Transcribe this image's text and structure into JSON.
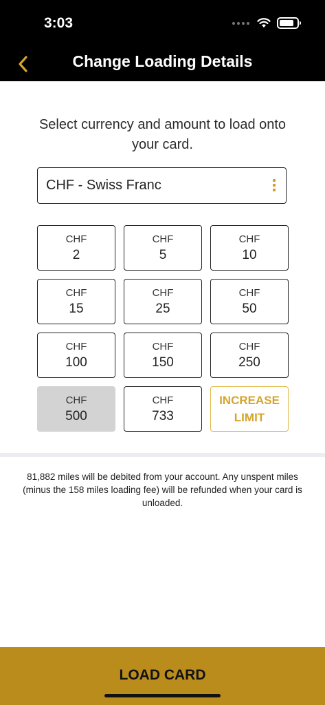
{
  "status_bar": {
    "time": "3:03"
  },
  "header": {
    "title": "Change Loading Details"
  },
  "instruction": "Select currency and amount to load onto your card.",
  "currency_select": {
    "value": "CHF - Swiss Franc"
  },
  "amounts": [
    {
      "currency": "CHF",
      "amount": "2"
    },
    {
      "currency": "CHF",
      "amount": "5"
    },
    {
      "currency": "CHF",
      "amount": "10"
    },
    {
      "currency": "CHF",
      "amount": "15"
    },
    {
      "currency": "CHF",
      "amount": "25"
    },
    {
      "currency": "CHF",
      "amount": "50"
    },
    {
      "currency": "CHF",
      "amount": "100"
    },
    {
      "currency": "CHF",
      "amount": "150"
    },
    {
      "currency": "CHF",
      "amount": "250"
    },
    {
      "currency": "CHF",
      "amount": "500"
    },
    {
      "currency": "CHF",
      "amount": "733"
    }
  ],
  "increase_limit": {
    "line1": "INCREASE",
    "line2": "LIMIT"
  },
  "note": "81,882 miles will be debited from your account. Any unspent miles (minus the 158 miles loading fee) will be refunded when your card is unloaded.",
  "load_button": {
    "label": "LOAD CARD"
  },
  "colors": {
    "accent": "#d5a52c",
    "button": "#b98c1c",
    "header_bg": "#000000",
    "selected_tile": "#d3d3d3"
  }
}
